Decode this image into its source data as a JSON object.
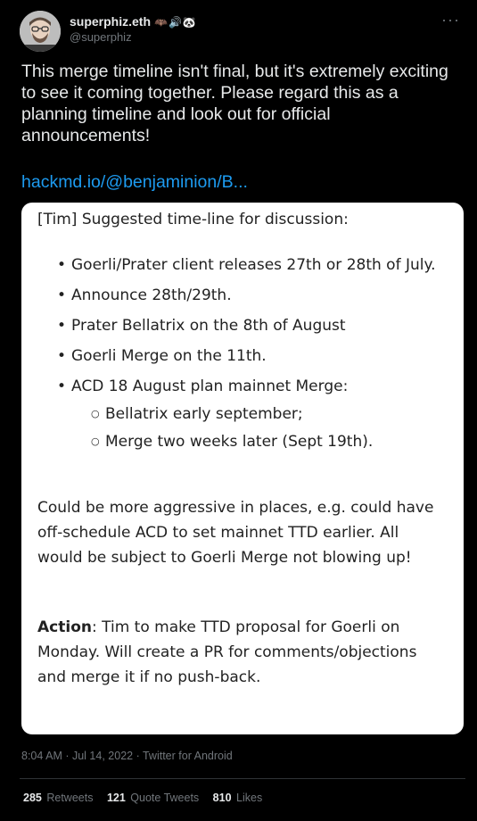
{
  "author": {
    "display_name": "superphiz.eth",
    "name_emojis": "🦇🔊🐼",
    "handle": "@superphiz"
  },
  "tweet": {
    "text": "This merge timeline isn't final, but it's extremely exciting to see it coming together. Please regard this as a planning timeline and look out for official announcements!",
    "link": "hackmd.io/@benjaminion/B..."
  },
  "card": {
    "heading": "[Tim] Suggested time-line for discussion:",
    "bullets": [
      "Goerli/Prater client releases 27th or 28th of July.",
      "Announce 28th/29th.",
      "Prater Bellatrix on the 8th of August",
      "Goerli Merge on the 11th.",
      "ACD 18 August plan mainnet Merge:"
    ],
    "subbullets": [
      "Bellatrix early september;",
      "Merge two weeks later (Sept 19th)."
    ],
    "paragraph": "Could be more aggressive in places, e.g. could have off-schedule ACD to set mainnet TTD earlier. All would be subject to Goerli Merge not blowing up!",
    "action_label": "Action",
    "action_text": ": Tim to make TTD proposal for Goerli on Monday. Will create a PR for comments/objections and merge it if no push-back."
  },
  "meta": {
    "time": "8:04 AM",
    "date": "Jul 14, 2022",
    "source": "Twitter for Android",
    "separator": " · "
  },
  "stats": {
    "retweets": "285",
    "retweets_label": "Retweets",
    "quote_tweets": "121",
    "quote_tweets_label": "Quote Tweets",
    "likes": "810",
    "likes_label": "Likes"
  },
  "icons": {
    "more": "more-horizontal-icon"
  },
  "colors": {
    "background": "#000000",
    "text": "#e7e9ea",
    "muted": "#71767b",
    "link": "#1d9bf0",
    "card": "#ffffff"
  }
}
